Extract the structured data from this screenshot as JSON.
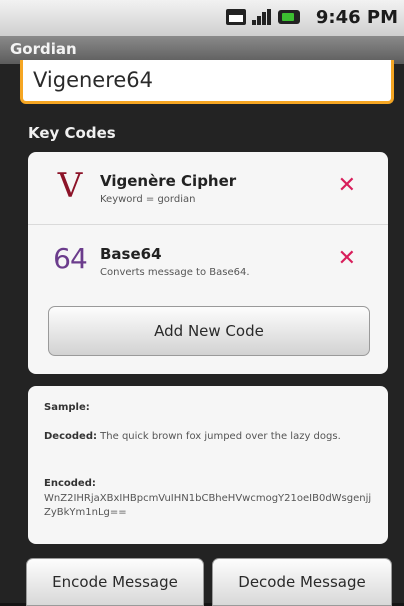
{
  "status_bar": {
    "time": "9:46 PM"
  },
  "app": {
    "title": "Gordian"
  },
  "code_name_input": {
    "value": "Vigenere64"
  },
  "key_codes": {
    "title": "Key Codes",
    "items": [
      {
        "symbol": "V",
        "name": "Vigenère Cipher",
        "description": "Keyword = gordian"
      },
      {
        "symbol": "64",
        "name": "Base64",
        "description": "Converts message to Base64."
      }
    ],
    "delete_glyph": "✕",
    "add_label": "Add New Code"
  },
  "sample": {
    "title": "Sample:",
    "decoded_label": "Decoded:",
    "decoded_text": " The quick brown fox jumped over the lazy dogs.",
    "encoded_label": "Encoded:",
    "encoded_text": "WnZ2IHRjaXBxIHBpcmVuIHN1bCBheHVwcmogY21oeIB0dWsgenjjZyBkYm1nLg=="
  },
  "actions": {
    "encode_label": "Encode Message",
    "decode_label": "Decode Message"
  },
  "colors": {
    "accent_orange": "#f5a623",
    "delete_red": "#d81e5b",
    "cipher_red": "#8c1328",
    "base64_purple": "#6b3c8c"
  }
}
